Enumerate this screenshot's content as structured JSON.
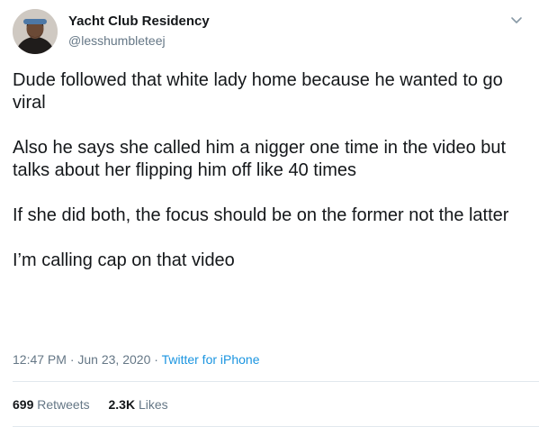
{
  "user": {
    "display_name": "Yacht Club Residency",
    "handle": "@lesshumbleteej"
  },
  "icons": {
    "avatar": "profile-photo",
    "caret": "chevron-down-icon"
  },
  "tweet": {
    "paragraphs": [
      "Dude followed that white lady home because he wanted to go viral",
      "Also he says she called him a nigger one time in the video but talks about her flipping him off like 40 times",
      "If she did both, the focus should be on the former not the latter",
      "I’m calling cap on that video"
    ],
    "time": "12:47 PM",
    "date": "Jun 23, 2020",
    "separator": "·",
    "source": "Twitter for iPhone"
  },
  "stats": {
    "retweets_count": "699",
    "retweets_label": "Retweets",
    "likes_count": "2.3K",
    "likes_label": "Likes"
  },
  "colors": {
    "text": "#14171a",
    "secondary": "#657786",
    "link": "#1b95e0",
    "divider": "#e1e8ed"
  }
}
